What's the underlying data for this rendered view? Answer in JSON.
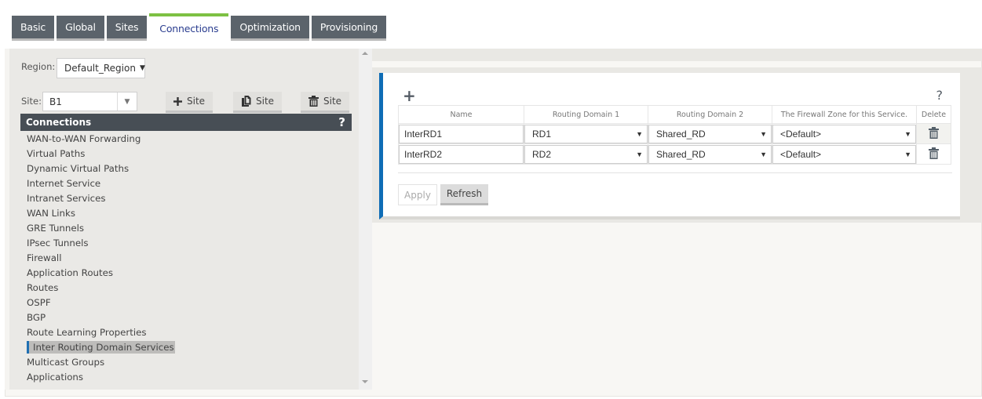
{
  "tabs": [
    {
      "label": "Basic",
      "active": false
    },
    {
      "label": "Global",
      "active": false
    },
    {
      "label": "Sites",
      "active": false
    },
    {
      "label": "Connections",
      "active": true
    },
    {
      "label": "Optimization",
      "active": false
    },
    {
      "label": "Provisioning",
      "active": false
    }
  ],
  "left_panel": {
    "region_label": "Region:",
    "region_value": "Default_Region",
    "site_label": "Site:",
    "site_value": "B1",
    "add_site_label": "Site",
    "copy_site_label": "Site",
    "delete_site_label": "Site",
    "section_title": "Connections",
    "help_label": "?",
    "nav_items": [
      "WAN-to-WAN Forwarding",
      "Virtual Paths",
      "Dynamic Virtual Paths",
      "Internet Service",
      "Intranet Services",
      "WAN Links",
      "GRE Tunnels",
      "IPsec Tunnels",
      "Firewall",
      "Application Routes",
      "Routes",
      "OSPF",
      "BGP",
      "Route Learning Properties",
      "Inter Routing Domain Services",
      "Multicast Groups",
      "Applications"
    ],
    "active_nav_item": "Inter Routing Domain Services"
  },
  "main": {
    "add_label": "+",
    "help_label": "?",
    "columns": [
      "Name",
      "Routing Domain 1",
      "Routing Domain 2",
      "The Firewall Zone for this Service.",
      "Delete"
    ],
    "rows": [
      {
        "name": "InterRD1",
        "rd1": "RD1",
        "rd2": "Shared_RD",
        "zone": "<Default>"
      },
      {
        "name": "InterRD2",
        "rd1": "RD2",
        "rd2": "Shared_RD",
        "zone": "<Default>"
      }
    ],
    "apply_label": "Apply",
    "refresh_label": "Refresh"
  },
  "colors": {
    "active_tab_indicator": "#7dc143",
    "accent_blue": "#0f6db6",
    "tab_bg": "#5b636b",
    "header_bg": "#474e55"
  }
}
